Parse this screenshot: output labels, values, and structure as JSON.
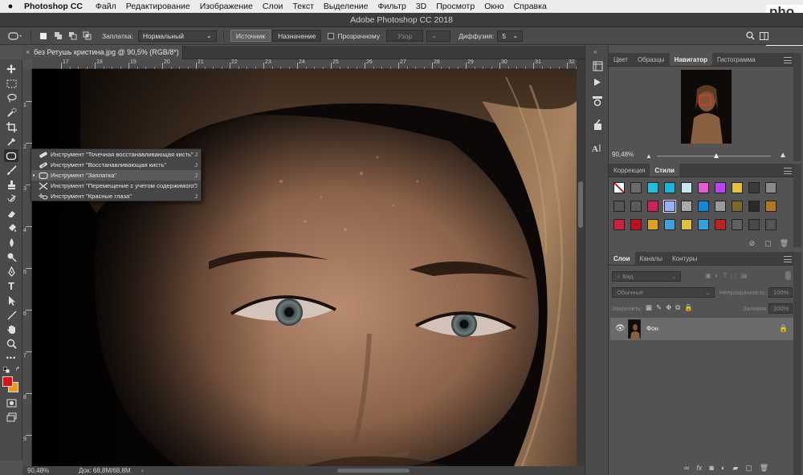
{
  "menubar": {
    "app": "Photoshop CC",
    "items": [
      "Файл",
      "Редактирование",
      "Изображение",
      "Слои",
      "Текст",
      "Выделение",
      "Фильтр",
      "3D",
      "Просмотр",
      "Окно",
      "Справка"
    ]
  },
  "window": {
    "title": "Adobe Photoshop CC 2018"
  },
  "options": {
    "tool_label": "Заплатка:",
    "mode_value": "Нормальный",
    "source_label": "Источник",
    "dest_label": "Назначение",
    "transparent_label": "Прозрачному",
    "pattern_label": "Узор",
    "diffusion_label": "Диффузия:",
    "diffusion_value": "5"
  },
  "document": {
    "tab_title": "без Ретушь кристина.jpg @ 90,5% (RGB/8*) *",
    "zoom": "90,48%",
    "doc_size": "Док: 68,8M/68,8M"
  },
  "ruler": {
    "h_labels": [
      "17",
      "18",
      "19",
      "20",
      "21",
      "22",
      "23",
      "24",
      "25",
      "26",
      "27",
      "28",
      "29",
      "30",
      "31",
      "32"
    ],
    "v_labels": [
      "1",
      "2",
      "3",
      "4",
      "5",
      "6",
      "7",
      "8",
      "9"
    ]
  },
  "flyout": {
    "items": [
      {
        "label": "Инструмент \"Точечная восстанавливающая кисть\"",
        "key": "J",
        "icon": "spot-healing-icon",
        "selected": false
      },
      {
        "label": "Инструмент \"Восстанавливающая кисть\"",
        "key": "J",
        "icon": "healing-brush-icon",
        "selected": false
      },
      {
        "label": "Инструмент \"Заплатка\"",
        "key": "J",
        "icon": "patch-icon",
        "selected": true
      },
      {
        "label": "Инструмент \"Перемещение с учетом содержимого\"",
        "key": "J",
        "icon": "content-aware-move-icon",
        "selected": false
      },
      {
        "label": "Инструмент \"Красные глаза\"",
        "key": "J",
        "icon": "red-eye-icon",
        "selected": false
      }
    ]
  },
  "panels": {
    "navigator": {
      "tabs": [
        "Цвет",
        "Образцы",
        "Навигатор",
        "Гистограмма"
      ],
      "active": "Навигатор",
      "zoom": "90,48%"
    },
    "styles": {
      "tabs": [
        "Коррекция",
        "Стили"
      ],
      "active": "Стили"
    },
    "layers": {
      "tabs": [
        "Слои",
        "Каналы",
        "Контуры"
      ],
      "active": "Слои",
      "filter_kind": "Вид",
      "blend_mode": "Обычные",
      "opacity_label": "Непрозрачность:",
      "opacity_value": "100%",
      "lock_label": "Закрепить:",
      "fill_label": "Заливка:",
      "fill_value": "100%",
      "layer_name": "Фон"
    }
  },
  "colors": {
    "foreground": "#e01010",
    "background": "#f09a1a",
    "canvas_bg": "#0c0908",
    "panel_bg": "#535353"
  },
  "watermark": {
    "text": "pho\nex"
  }
}
